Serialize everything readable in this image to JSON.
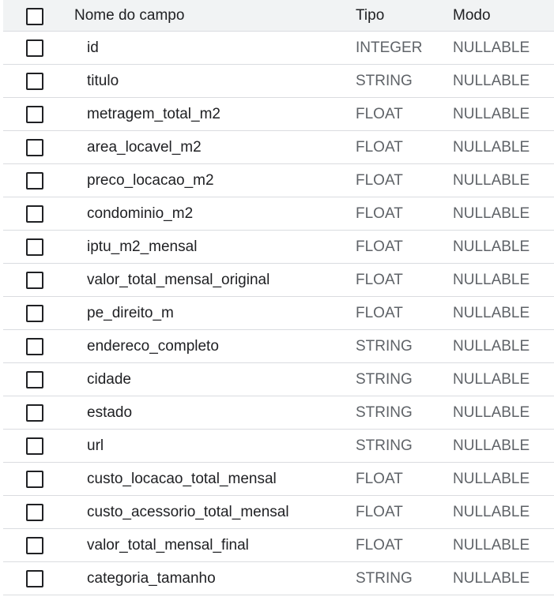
{
  "header": {
    "name_label": "Nome do campo",
    "type_label": "Tipo",
    "mode_label": "Modo"
  },
  "rows": [
    {
      "name": "id",
      "type": "INTEGER",
      "mode": "NULLABLE"
    },
    {
      "name": "titulo",
      "type": "STRING",
      "mode": "NULLABLE"
    },
    {
      "name": "metragem_total_m2",
      "type": "FLOAT",
      "mode": "NULLABLE"
    },
    {
      "name": "area_locavel_m2",
      "type": "FLOAT",
      "mode": "NULLABLE"
    },
    {
      "name": "preco_locacao_m2",
      "type": "FLOAT",
      "mode": "NULLABLE"
    },
    {
      "name": "condominio_m2",
      "type": "FLOAT",
      "mode": "NULLABLE"
    },
    {
      "name": "iptu_m2_mensal",
      "type": "FLOAT",
      "mode": "NULLABLE"
    },
    {
      "name": "valor_total_mensal_original",
      "type": "FLOAT",
      "mode": "NULLABLE"
    },
    {
      "name": "pe_direito_m",
      "type": "FLOAT",
      "mode": "NULLABLE"
    },
    {
      "name": "endereco_completo",
      "type": "STRING",
      "mode": "NULLABLE"
    },
    {
      "name": "cidade",
      "type": "STRING",
      "mode": "NULLABLE"
    },
    {
      "name": "estado",
      "type": "STRING",
      "mode": "NULLABLE"
    },
    {
      "name": "url",
      "type": "STRING",
      "mode": "NULLABLE"
    },
    {
      "name": "custo_locacao_total_mensal",
      "type": "FLOAT",
      "mode": "NULLABLE"
    },
    {
      "name": "custo_acessorio_total_mensal",
      "type": "FLOAT",
      "mode": "NULLABLE"
    },
    {
      "name": "valor_total_mensal_final",
      "type": "FLOAT",
      "mode": "NULLABLE"
    },
    {
      "name": "categoria_tamanho",
      "type": "STRING",
      "mode": "NULLABLE"
    }
  ],
  "colors": {
    "header_bg": "#f1f3f4",
    "divider": "#dadce0",
    "text_primary": "#202124",
    "text_secondary": "#5f6368"
  }
}
